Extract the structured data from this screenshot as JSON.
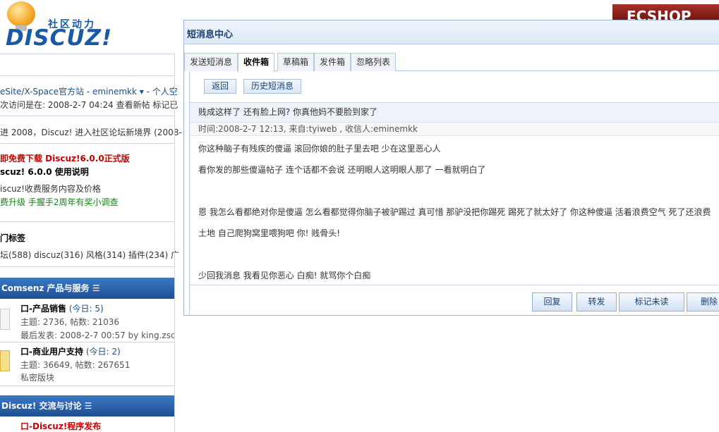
{
  "site": {
    "slogan": "社区动力",
    "brand": "DISCUZ!",
    "ad_text": "ECSHOP ECS"
  },
  "background": {
    "lines": [
      {
        "text": "eSite/X-Space官方站 - eminemkk ▾ - 个人空"
      },
      {
        "text": "次访问是在: 2008-2-7 04:24  查看新帖  标记已"
      },
      {
        "text": "进  2008，Discuz! 进入社区论坛新境界 (2008-"
      },
      {
        "text": "即免费下载  Discuz!6.0.0正式版"
      },
      {
        "text": "scuz! 6.0.0 使用说明"
      },
      {
        "text": "iscuz!收费服务内容及价格"
      },
      {
        "text": "费升级  手握手2周年有奖小调查"
      },
      {
        "text": "门标签"
      },
      {
        "text": "坛(588)  discuz(316)  风格(314)  插件(234)  广"
      }
    ],
    "section_1": "Comsenz 产品与服务 ☰",
    "forum_1": {
      "name": "口-产品销售",
      "today": "(今日: 5)",
      "stats": "主题: 2736, 帖数: 21036",
      "last": "最后发表: 2008-2-7 00:57 by king.zsc"
    },
    "forum_2": {
      "name": "口-商业用户支持",
      "today": "(今日: 2)",
      "stats": "主题: 36649, 帖数: 267651",
      "note": "私密版块"
    },
    "section_2": "Discuz! 交流与讨论  ☰",
    "forum_3": {
      "name": "口-Discuz!程序发布"
    }
  },
  "dialog": {
    "title": "短消息中心",
    "tabs": [
      {
        "label": "发送短消息",
        "active": false
      },
      {
        "label": "收件箱",
        "active": true
      },
      {
        "label": "草稿箱",
        "active": false
      },
      {
        "label": "发件箱",
        "active": false
      },
      {
        "label": "忽略列表",
        "active": false
      }
    ],
    "back_label": "返回",
    "history_label": "历史短消息",
    "message": {
      "subject": "贱成这样了 还有脸上网? 你真他妈不要脸到家了",
      "meta": "时间:2008-2-7 12:13, 来自:tyiweb , 收信人:eminemkk",
      "lines": [
        "你这种脑子有残疾的傻逼 滚回你娘的肚子里去吧 少在这里恶心人",
        "看你发的那些傻逼帖子 连个话都不会说 还明眼人这明眼人那了 一看就明白了",
        "恩 我怎么看都绝对你是傻逼 怎么看都觉得你脑子被驴踢过 真可惜 那驴没把你踢死 踢死了就太好了 你这种傻逼 活着浪费空气 死了还浪费",
        "土地 自己爬狗窝里喂狗吧 你! 贱骨头!",
        "少回我消息 我看见你恶心 白痴! 就骂你个白痴"
      ]
    },
    "actions": {
      "reply": "回复",
      "forward": "转发",
      "mark_unread": "标记未读",
      "delete": "删除"
    }
  },
  "colors": {
    "accent": "#1a5aa5",
    "section_bar": "#2a63ab",
    "highlight_red": "#cc0000"
  }
}
